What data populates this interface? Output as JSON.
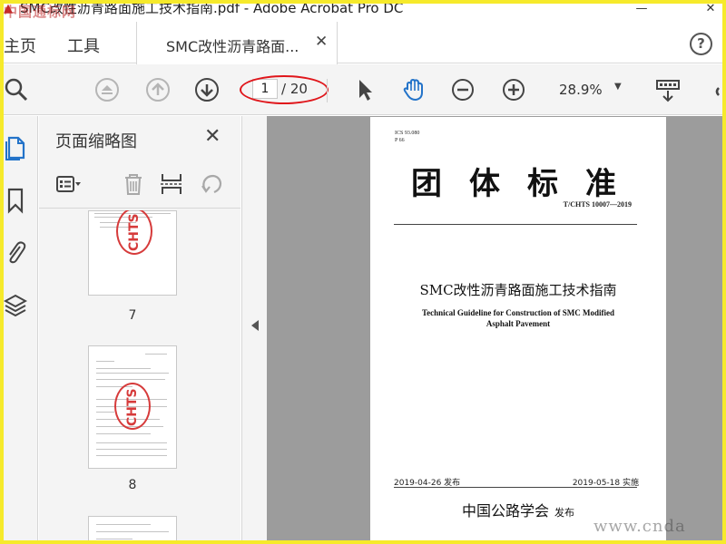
{
  "window": {
    "title": "SMC改性沥青路面施工技术指南.pdf - Adobe Acrobat Pro DC",
    "watermark_top": "中国通标网",
    "minimize": "—",
    "close": "✕"
  },
  "tabs": {
    "home": "主页",
    "tools": "工具",
    "document": "SMC改性沥青路面...",
    "document_close": "✕",
    "help": "?"
  },
  "toolbar": {
    "current_page": "1",
    "total_pages": "/ 20",
    "zoom": "28.9%",
    "zoom_caret": "▼"
  },
  "thumbnail_panel": {
    "title": "页面缩略图",
    "close": "✕",
    "pages": [
      {
        "number": "7",
        "stamp": "CHTS"
      },
      {
        "number": "8",
        "stamp": "CHTS"
      }
    ]
  },
  "document_page": {
    "ics_line1": "ICS 93.080",
    "ics_line2": "P 66",
    "big_title": "团体标准",
    "standard_number": "T/CHTS 10007—2019",
    "chinese_title": "SMC改性沥青路面施工技术指南",
    "english_title_line1": "Technical Guideline for Construction of  SMC Modified",
    "english_title_line2": "Asphalt Pavement",
    "issue_date": "2019-04-26  发布",
    "implement_date": "2019-05-18  实施",
    "publisher": "中国公路学会",
    "publisher_suffix": "发布"
  },
  "watermark_bottom": "www.cnda"
}
